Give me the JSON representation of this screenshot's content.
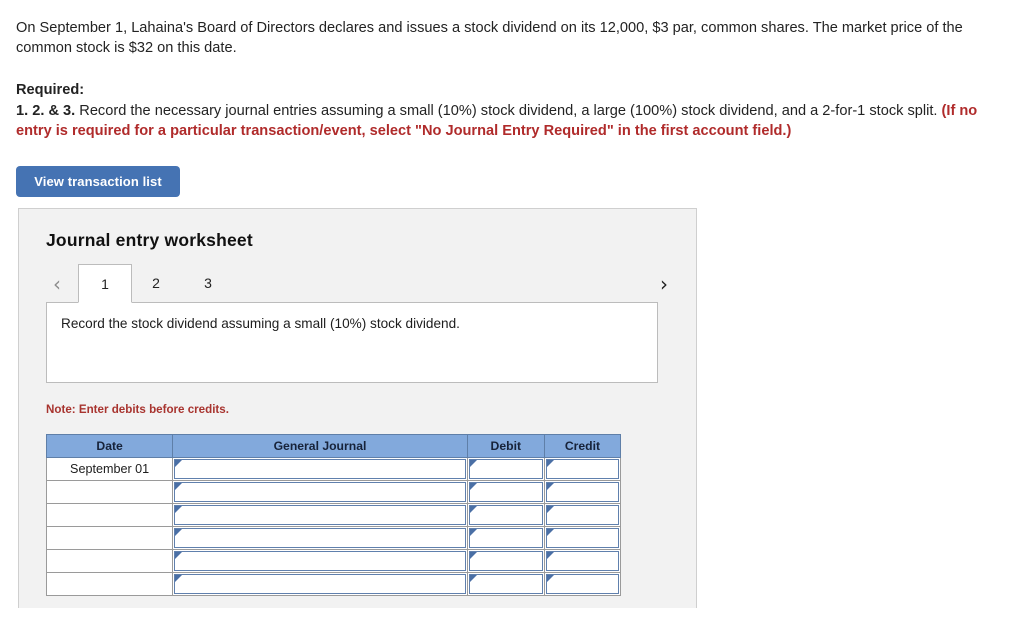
{
  "problem": {
    "text": "On September 1, Lahaina's Board of Directors declares and issues a stock dividend on its 12,000, $3 par, common shares. The market price of the common stock is $32 on this date."
  },
  "required": {
    "label": "Required:",
    "numbers": "1. 2. & 3.",
    "body": " Record the necessary journal entries assuming a small (10%) stock dividend, a large (100%) stock dividend, and a 2-for-1 stock split. ",
    "red_note": "(If no entry is required for a particular transaction/event, select \"No Journal Entry Required\" in the first account field.)"
  },
  "toolbar": {
    "view_transaction_list_label": "View transaction list"
  },
  "worksheet": {
    "title": "Journal entry worksheet",
    "prev_icon": "‹",
    "next_icon": "›",
    "tabs": [
      {
        "label": "1",
        "active": true
      },
      {
        "label": "2",
        "active": false
      },
      {
        "label": "3",
        "active": false
      }
    ],
    "instruction": "Record the stock dividend assuming a small (10%) stock dividend.",
    "note": "Note: Enter debits before credits."
  },
  "journal_table": {
    "headers": [
      "Date",
      "General Journal",
      "Debit",
      "Credit"
    ],
    "rows": [
      {
        "date": "September 01",
        "general_journal": "",
        "debit": "",
        "credit": ""
      },
      {
        "date": "",
        "general_journal": "",
        "debit": "",
        "credit": ""
      },
      {
        "date": "",
        "general_journal": "",
        "debit": "",
        "credit": ""
      },
      {
        "date": "",
        "general_journal": "",
        "debit": "",
        "credit": ""
      },
      {
        "date": "",
        "general_journal": "",
        "debit": "",
        "credit": ""
      },
      {
        "date": "",
        "general_journal": "",
        "debit": "",
        "credit": ""
      }
    ]
  },
  "colors": {
    "button_blue": "#4573b3",
    "table_header_blue": "#82a9dc",
    "note_red": "#a8342f",
    "panel_bg": "#f2f2f2"
  }
}
